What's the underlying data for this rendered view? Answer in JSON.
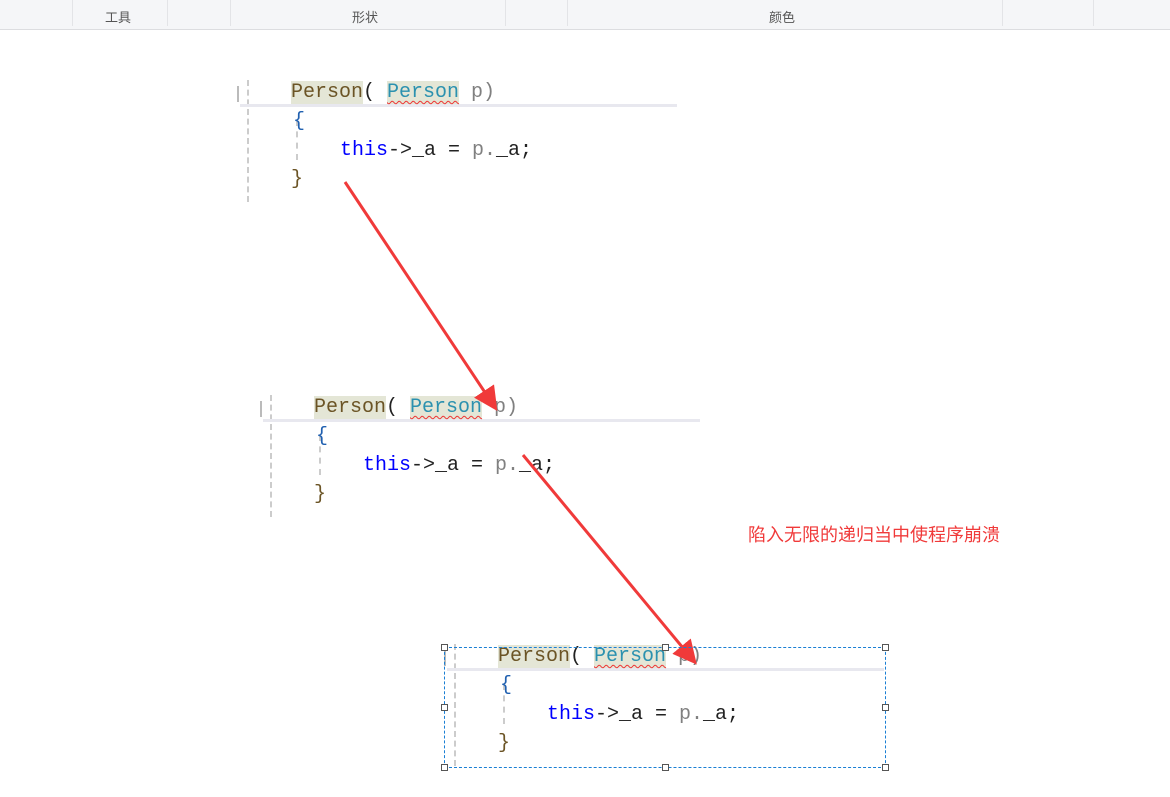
{
  "toolbar": {
    "items": [
      "工具",
      "形状",
      "颜色"
    ]
  },
  "code": {
    "sig_name": "Person",
    "sig_open": "( ",
    "sig_type": "Person",
    "sig_param": " p)",
    "open_brace": "{",
    "body_kw": "this",
    "body_rest": "->_a = ",
    "body_p": "p.",
    "body_field": "_a;",
    "close_brace": "}"
  },
  "annotation": "陷入无限的递归当中使程序崩溃",
  "colors": {
    "arrow": "#f03a3a",
    "selection": "#1a7fd4"
  }
}
